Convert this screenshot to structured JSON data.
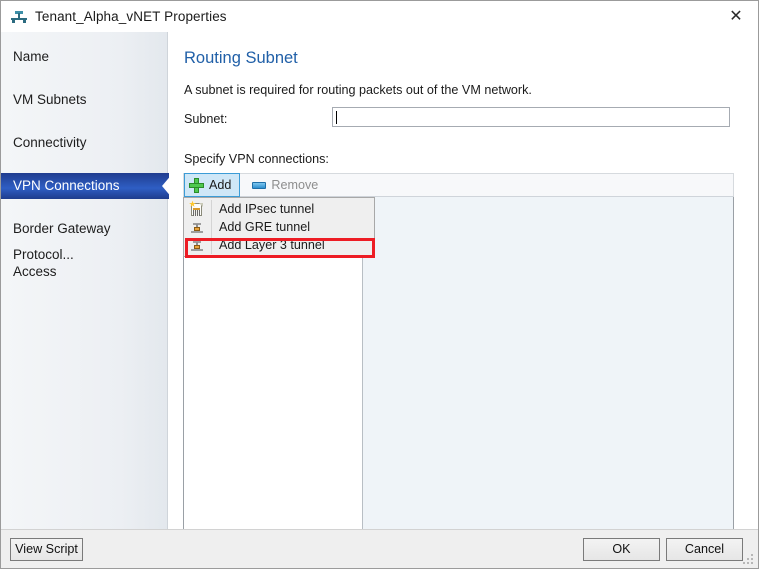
{
  "window": {
    "title": "Tenant_Alpha_vNET Properties",
    "icon": "network-vnet-icon",
    "close_label": "✕"
  },
  "sidebar": {
    "items": [
      {
        "label": "Name",
        "selected": false
      },
      {
        "label": "VM Subnets",
        "selected": false
      },
      {
        "label": "Connectivity",
        "selected": false
      },
      {
        "label": "VPN Connections",
        "selected": true
      },
      {
        "label": "Border Gateway Protocol...",
        "selected": false
      },
      {
        "label": "Access",
        "selected": false
      }
    ]
  },
  "content": {
    "heading": "Routing Subnet",
    "description": "A subnet is required for routing packets out of the VM network.",
    "subnet_label": "Subnet:",
    "subnet_value": "",
    "subnet_placeholder": "",
    "specify_label": "Specify VPN connections:"
  },
  "toolbar": {
    "add_label": "Add",
    "add_icon": "green-plus-icon",
    "remove_label": "Remove",
    "remove_icon": "blue-minus-icon",
    "add_active": true,
    "remove_disabled": true
  },
  "menu": {
    "open": true,
    "items": [
      {
        "label": "Add IPsec tunnel",
        "icon": "new-document-star-icon",
        "highlighted": false
      },
      {
        "label": "Add GRE tunnel",
        "icon": "tunnel-node-icon",
        "highlighted": false
      },
      {
        "label": "Add Layer 3 tunnel",
        "icon": "tunnel-node-icon",
        "highlighted": true
      }
    ]
  },
  "footer": {
    "view_script_label": "View Script",
    "ok_label": "OK",
    "cancel_label": "Cancel"
  },
  "colors": {
    "accent_blue": "#2160a8",
    "selection_blue": "#2a55b5",
    "highlight_red": "#ed1c24",
    "toolbar_active": "#cfe7f7",
    "panel_bg": "#eff4f8"
  }
}
